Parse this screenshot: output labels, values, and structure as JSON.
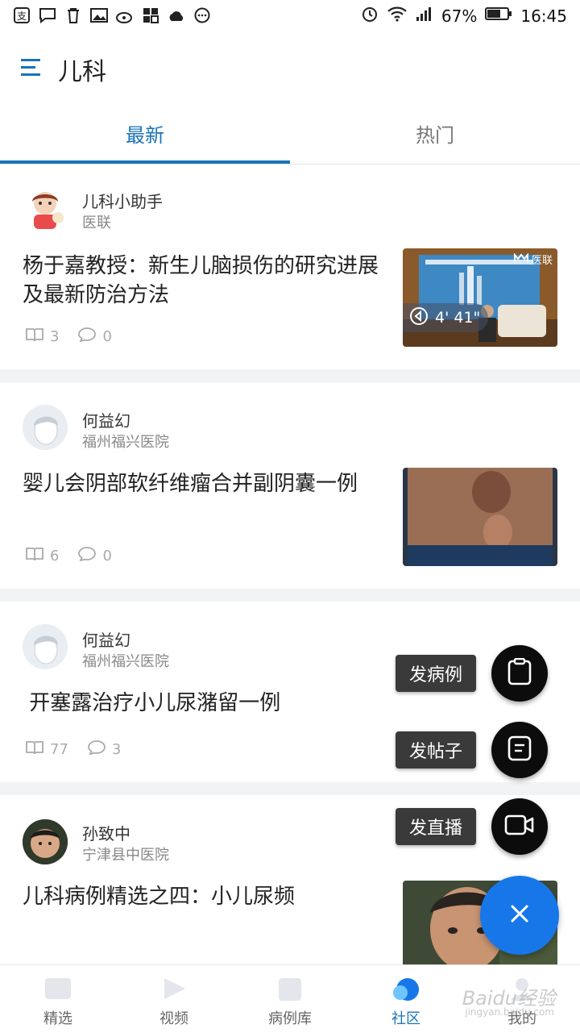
{
  "status_bar": {
    "battery": "67%",
    "time": "16:45"
  },
  "header": {
    "title": "儿科"
  },
  "tabs": [
    {
      "label": "最新"
    },
    {
      "label": "热门"
    }
  ],
  "posts": [
    {
      "author": "儿科小助手",
      "org": "医联",
      "title": "杨于嘉教授：新生儿脑损伤的研究进展及最新防治方法",
      "reads": "3",
      "comments": "0",
      "video_duration": "4' 41\"",
      "thumb_brand": "医联"
    },
    {
      "author": "何益幻",
      "org": "福州福兴医院",
      "title": "婴儿会阴部软纤维瘤合并副阴囊一例",
      "reads": "6",
      "comments": "0"
    },
    {
      "author": "何益幻",
      "org": "福州福兴医院",
      "title": " 开塞露治疗小儿尿潴留一例",
      "reads": "77",
      "comments": "3"
    },
    {
      "author": "孙致中",
      "org": "宁津县中医院",
      "title": "儿科病例精选之四：小儿尿频"
    }
  ],
  "fab_actions": [
    {
      "label": "发病例",
      "icon": "clipboard-icon"
    },
    {
      "label": "发帖子",
      "icon": "document-icon"
    },
    {
      "label": "发直播",
      "icon": "video-camera-icon"
    }
  ],
  "bottom_nav": [
    {
      "label": "精选"
    },
    {
      "label": "视频"
    },
    {
      "label": "病例库"
    },
    {
      "label": "社区"
    },
    {
      "label": "我的"
    }
  ],
  "watermark": {
    "text": "Baidu经验",
    "sub": "jingyan.baidu.com"
  },
  "colors": {
    "accent": "#1a73b8",
    "fab": "#1877e8"
  }
}
